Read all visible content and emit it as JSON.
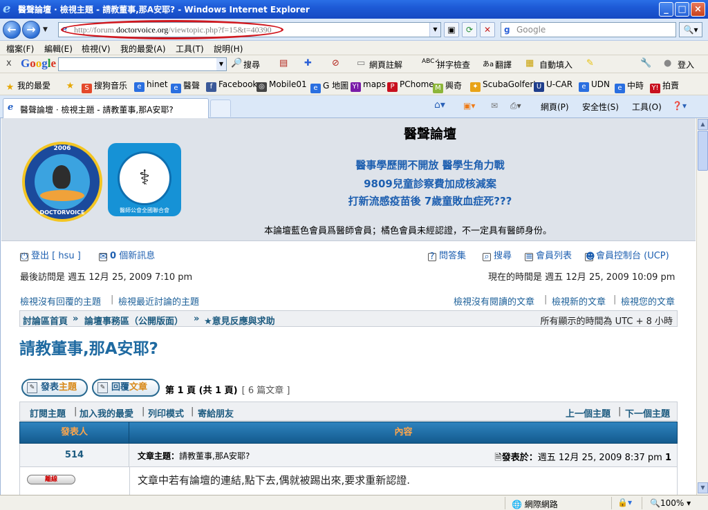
{
  "window": {
    "title": "醫聲論壇 · 檢視主題 - 請教董事,那A安耶? - Windows Internet Explorer"
  },
  "address": {
    "url_dim_prefix": "http://forum.",
    "url_domain": "doctorvoice.org",
    "url_path": "/viewtopic.php?f=15&t=40390"
  },
  "search": {
    "placeholder": "Google"
  },
  "menu": [
    "檔案(F)",
    "編輯(E)",
    "檢視(V)",
    "我的最愛(A)",
    "工具(T)",
    "說明(H)"
  ],
  "google_toolbar": {
    "logo": "Google",
    "items": [
      "搜尋",
      "網頁註解",
      "拼字檢查",
      "翻譯",
      "自動填入",
      "登入"
    ]
  },
  "favorites": [
    "我的最愛",
    "搜狗音乐",
    "hinet",
    "醫聲",
    "Facebook",
    "Mobile01",
    "G 地圖",
    "maps",
    "PChome",
    "興奇",
    "ScubaGolfer's",
    "U-CAR",
    "UDN",
    "中時",
    "拍賣"
  ],
  "tab": {
    "title": "醫聲論壇 · 檢視主題 - 請教董事,那A安耶?"
  },
  "command_bar": {
    "page": "網頁(P)",
    "safety": "安全性(S)",
    "tools": "工具(O)"
  },
  "forum": {
    "logo1_year": "2006",
    "logo1_brand": "DOCTORVOICE",
    "logo2_label": "醫師公會全國聯合會",
    "site_title": "醫聲論壇",
    "headlines": [
      "醫事學歷開不開放 醫學生角力戰",
      "9809兒童診察費加成核減案",
      "打新流感疫苗後 7歲童敗血症死???"
    ],
    "notice": "本論壇藍色會員爲醫師會員；橘色會員未經認證，不一定具有醫師身份。",
    "logout": "登出 [ hsu ]",
    "new_messages_count": "0",
    "new_messages_label": "個新訊息",
    "faq": "問答集",
    "search": "搜尋",
    "members": "會員列表",
    "ucp": "會員控制台 (UCP)",
    "last_visit": "最後訪問是 週五 12月 25, 2009 7:10 pm",
    "current_time": "現在的時間是 週五 12月 25, 2009 10:09 pm",
    "view_unanswered": "檢視沒有回覆的主題",
    "view_active": "檢視最近討論的主題",
    "view_unread": "檢視沒有閱讀的文章",
    "view_new": "檢視新的文章",
    "view_yours": "檢視您的文章",
    "crumbs": [
      "討論區首頁",
      "論壇事務區（公開版面）",
      "★意見反應與求助"
    ],
    "timezone": "所有顯示的時間為 UTC + 8 小時",
    "topic_title": "請教董事,那A安耶?",
    "btn_new_topic_a": "發表",
    "btn_new_topic_b": "主題",
    "btn_reply_a": "回覆",
    "btn_reply_b": "文章",
    "page_info": "第 1 頁 (共 1 頁)",
    "post_count": "[ 6 篇文章 ]",
    "options": [
      "訂閱主題",
      "加入我的最愛",
      "列印模式",
      "寄給朋友"
    ],
    "prev_topic": "上一個主題",
    "next_topic": "下一個主題",
    "col_author": "發表人",
    "col_content": "內容",
    "post": {
      "author": "514",
      "subject_label": "文章主題：",
      "subject": "請教董事,那A安耶?",
      "posted_label": "發表於：",
      "posted": "週五 12月 25, 2009 8:37 pm",
      "post_number": "1",
      "status": "離線",
      "body_line1": "文章中若有論壇的連結,點下去,偶就被踢出來,要求重新認證."
    }
  },
  "status_bar": {
    "zone": "網際網路",
    "zoom": "100%"
  }
}
